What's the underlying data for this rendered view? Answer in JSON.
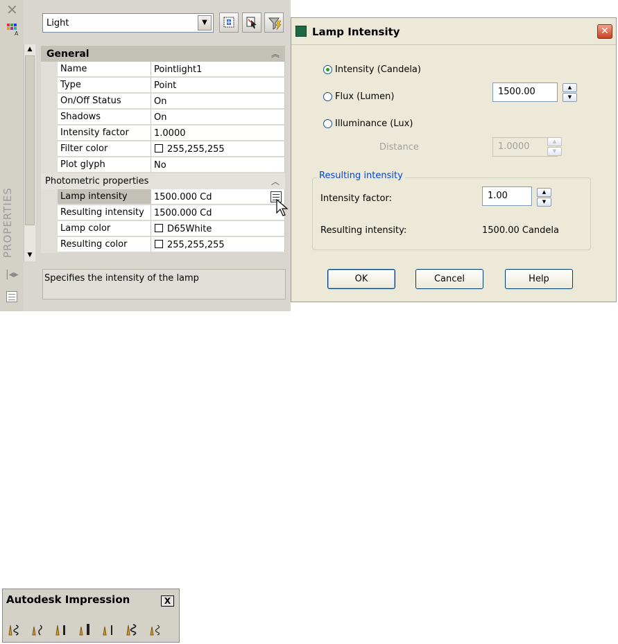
{
  "properties_palette": {
    "title": "PROPERTIES",
    "object_type": "Light",
    "categories": [
      {
        "label": "General",
        "collapse_icon": "chevron-double-up-icon"
      },
      {
        "label": "Photometric properties",
        "collapse_icon": "chevron-up-icon"
      }
    ],
    "general_rows": [
      {
        "name": "Name",
        "value": "Pointlight1"
      },
      {
        "name": "Type",
        "value": "Point"
      },
      {
        "name": "On/Off Status",
        "value": "On"
      },
      {
        "name": "Shadows",
        "value": "On"
      },
      {
        "name": "Intensity factor",
        "value": "1.0000"
      },
      {
        "name": "Filter color",
        "value": "255,255,255"
      },
      {
        "name": "Plot glyph",
        "value": "No"
      }
    ],
    "photometric_rows": [
      {
        "name": "Lamp intensity",
        "value": "1500.000 Cd"
      },
      {
        "name": "Resulting intensity",
        "value": "1500.000 Cd"
      },
      {
        "name": "Lamp color",
        "value": "D65White"
      },
      {
        "name": "Resulting color",
        "value": "255,255,255"
      }
    ],
    "description": "Specifies the intensity of the lamp"
  },
  "lamp_dialog": {
    "title": "Lamp Intensity",
    "options": [
      {
        "label": "Intensity (Candela)",
        "selected": true
      },
      {
        "label": "Flux (Lumen)",
        "selected": false
      },
      {
        "label": "Illuminance (Lux)",
        "selected": false
      }
    ],
    "flux_value": "1500.00",
    "distance_label": "Distance",
    "distance_value": "1.0000",
    "group_title": "Resulting intensity",
    "intensity_factor_label": "Intensity factor:",
    "intensity_factor_value": "1.00",
    "resulting_label": "Resulting intensity:",
    "resulting_value": "1500.00 Candela",
    "buttons": {
      "ok": "OK",
      "cancel": "Cancel",
      "help": "Help"
    }
  },
  "impression_toolbar": {
    "title": "Autodesk Impression",
    "close_label": "X",
    "tools": [
      "impression-tool-1-icon",
      "impression-tool-2-icon",
      "impression-tool-3-icon",
      "impression-tool-4-icon",
      "impression-tool-5-icon",
      "impression-tool-6-icon",
      "impression-tool-7-icon"
    ]
  },
  "colors": {
    "accent_blue": "#0046d5",
    "palette_bg": "#d8d6cf",
    "dialog_bg": "#ece9d8",
    "close_red": "#c94224"
  }
}
